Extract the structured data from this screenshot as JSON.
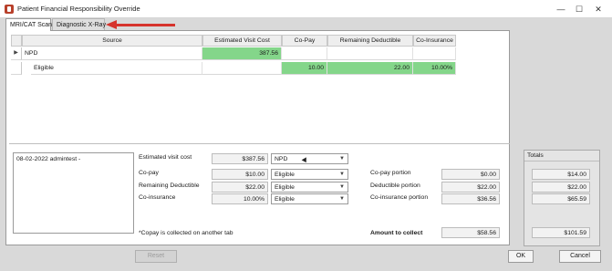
{
  "window": {
    "title": "Patient Financial Responsibility Override",
    "minimize": "—",
    "maximize": "☐",
    "close": "✕"
  },
  "tabs": [
    {
      "label": "MRI/CAT Scan",
      "active": true
    },
    {
      "label": "Diagnostic X-Ray",
      "active": false
    }
  ],
  "grid": {
    "columns": [
      "Source",
      "Estimated Visit Cost",
      "Co-Pay",
      "Remaining Deductible",
      "Co-Insurance"
    ],
    "rows": [
      {
        "indicator": "▶",
        "source": "NPD",
        "visit_cost": "387.56",
        "copay": "",
        "deductible": "",
        "coinsurance": ""
      },
      {
        "indicator": "",
        "source": "Eligible",
        "visit_cost": "",
        "copay": "10.00",
        "deductible": "22.00",
        "coinsurance": "10.00%"
      }
    ],
    "highlight_color": "#84d68a"
  },
  "note": {
    "text": "08-02-2022 admintest -"
  },
  "form": {
    "est_visit_cost_label": "Estimated visit cost",
    "est_visit_cost_value": "$387.56",
    "est_visit_cost_source": "NPD",
    "copay_label": "Co-pay",
    "copay_value": "$10.00",
    "copay_source": "Eligible",
    "deductible_label": "Remaining Deductible",
    "deductible_value": "$22.00",
    "deductible_source": "Eligible",
    "coinsurance_label": "Co-insurance",
    "coinsurance_value": "10.00%",
    "coinsurance_source": "Eligible",
    "copay_note": "*Copay is collected on another tab"
  },
  "portions": {
    "copay_portion_label": "Co-pay portion",
    "copay_portion_value": "$0.00",
    "deductible_portion_label": "Deductible portion",
    "deductible_portion_value": "$22.00",
    "coinsurance_portion_label": "Co-insurance portion",
    "coinsurance_portion_value": "$36.56",
    "amount_to_collect_label": "Amount to collect",
    "amount_to_collect_value": "$58.56"
  },
  "totals": {
    "header": "Totals",
    "copay_total": "$14.00",
    "deductible_total": "$22.00",
    "coinsurance_total": "$65.59",
    "grand_total": "$101.59"
  },
  "buttons": {
    "reset": "Reset",
    "ok": "OK",
    "cancel": "Cancel"
  }
}
